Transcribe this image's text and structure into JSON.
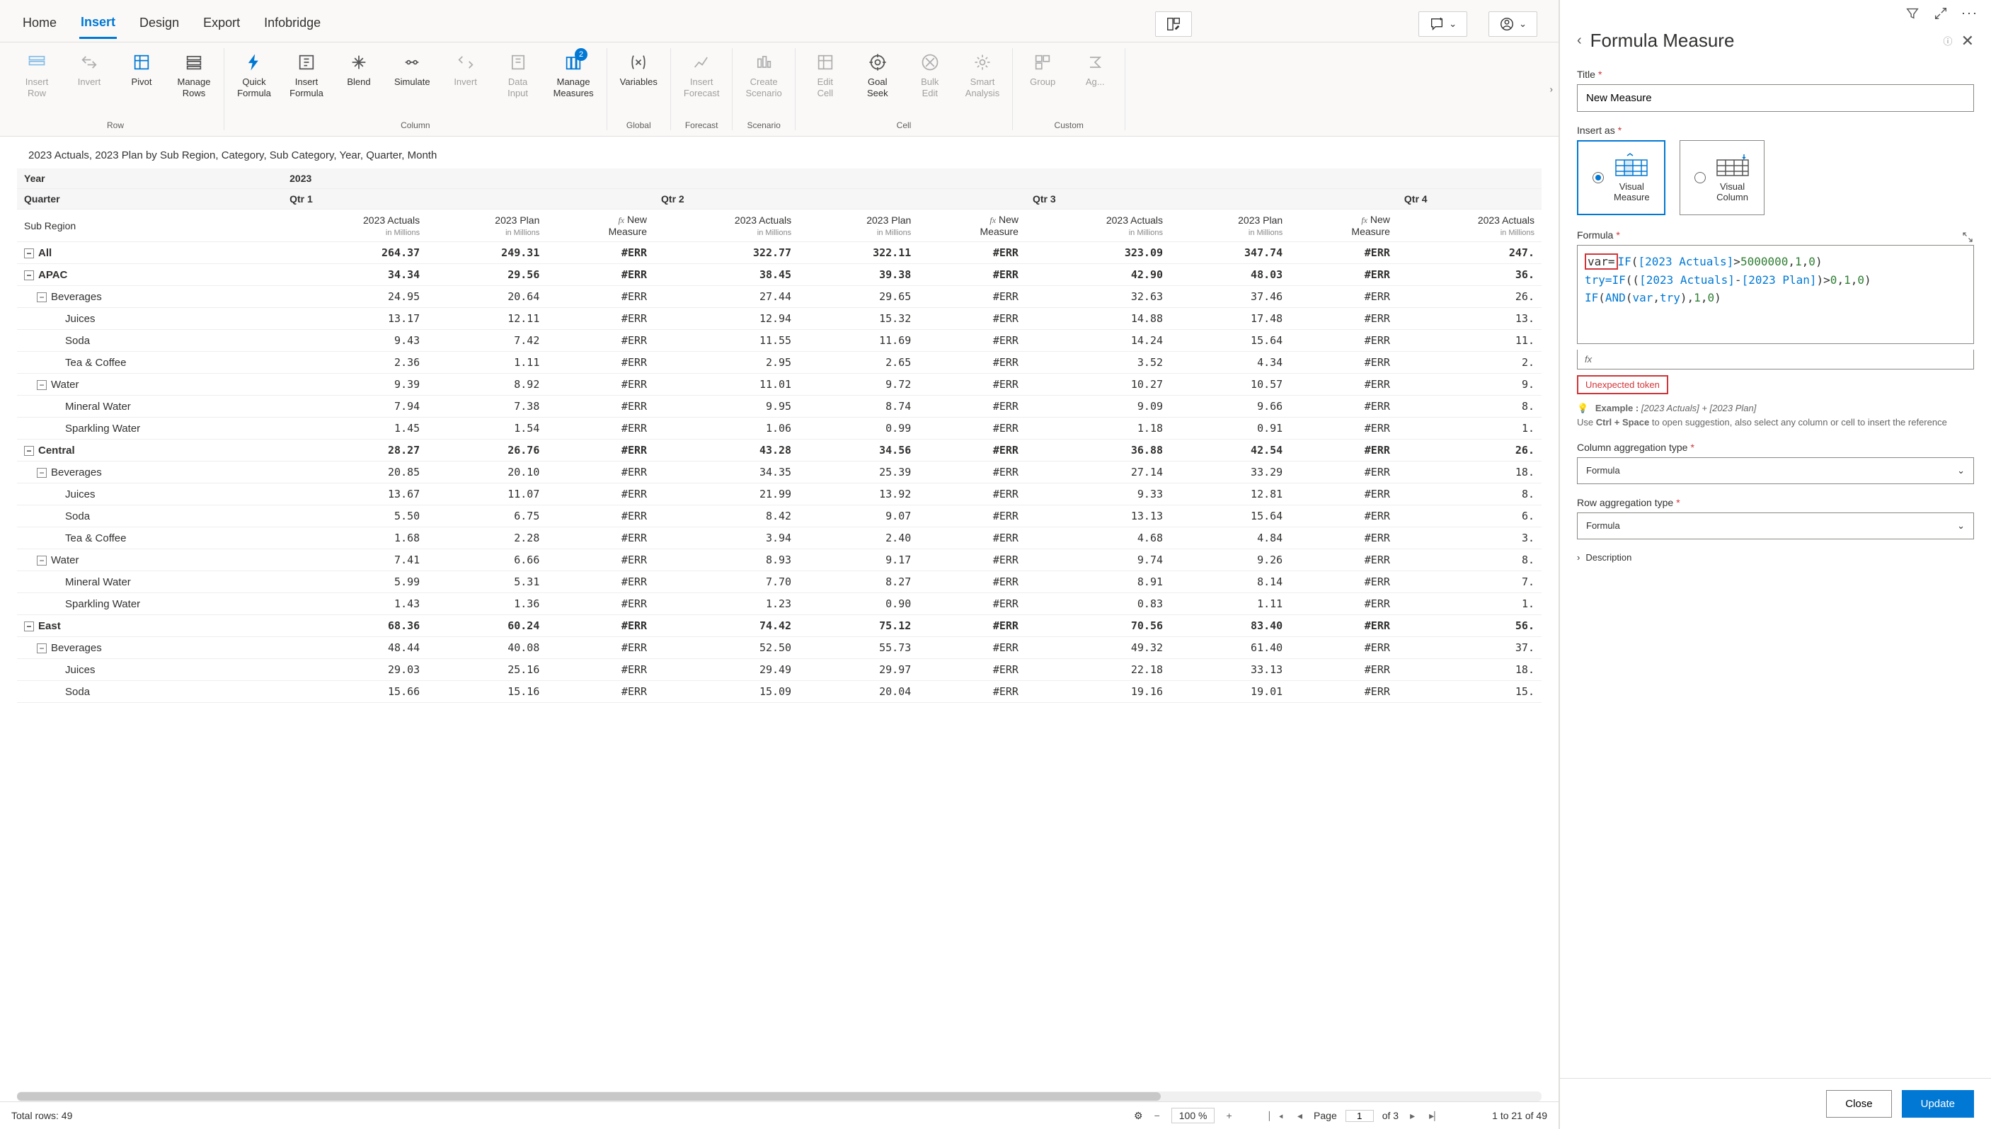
{
  "tabs": {
    "home": "Home",
    "insert": "Insert",
    "design": "Design",
    "export": "Export",
    "infobridge": "Infobridge"
  },
  "ribbon": {
    "groups": {
      "row": {
        "label": "Row",
        "insert_row": "Insert\nRow",
        "invert": "Invert",
        "pivot": "Pivot",
        "manage_rows": "Manage\nRows"
      },
      "column": {
        "label": "Column",
        "quick_formula": "Quick\nFormula",
        "insert_formula": "Insert\nFormula",
        "blend": "Blend",
        "simulate": "Simulate",
        "invert": "Invert",
        "data_input": "Data\nInput",
        "manage_measures": "Manage\nMeasures",
        "badge": "2"
      },
      "global": {
        "label": "Global",
        "variables": "Variables"
      },
      "forecast": {
        "label": "Forecast",
        "insert_forecast": "Insert\nForecast"
      },
      "scenario": {
        "label": "Scenario",
        "create_scenario": "Create\nScenario"
      },
      "cell": {
        "label": "Cell",
        "edit_cell": "Edit\nCell",
        "goal_seek": "Goal\nSeek",
        "bulk_edit": "Bulk\nEdit",
        "smart_analysis": "Smart\nAnalysis"
      },
      "custom": {
        "label": "Custom",
        "group": "Group",
        "aggregate": "Ag..."
      }
    }
  },
  "breadcrumb": "2023 Actuals, 2023 Plan by Sub Region, Category, Sub Category, Year, Quarter, Month",
  "headers": {
    "year_label": "Year",
    "quarter_label": "Quarter",
    "sub_region_label": "Sub Region",
    "year_value": "2023",
    "quarters": [
      "Qtr 1",
      "Qtr 2",
      "Qtr 3",
      "Qtr 4"
    ],
    "cols": {
      "actuals": "2023 Actuals",
      "plan": "2023 Plan",
      "new_measure": "New\nMeasure",
      "unit": "in Millions"
    }
  },
  "rows": [
    {
      "type": "all",
      "label": "All",
      "vals": [
        "264.37",
        "249.31",
        "#ERR",
        "322.77",
        "322.11",
        "#ERR",
        "323.09",
        "347.74",
        "#ERR",
        "247."
      ]
    },
    {
      "type": "region",
      "label": "APAC",
      "vals": [
        "34.34",
        "29.56",
        "#ERR",
        "38.45",
        "39.38",
        "#ERR",
        "42.90",
        "48.03",
        "#ERR",
        "36."
      ]
    },
    {
      "type": "cat",
      "label": "Beverages",
      "vals": [
        "24.95",
        "20.64",
        "#ERR",
        "27.44",
        "29.65",
        "#ERR",
        "32.63",
        "37.46",
        "#ERR",
        "26."
      ]
    },
    {
      "type": "item",
      "label": "Juices",
      "vals": [
        "13.17",
        "12.11",
        "#ERR",
        "12.94",
        "15.32",
        "#ERR",
        "14.88",
        "17.48",
        "#ERR",
        "13."
      ]
    },
    {
      "type": "item",
      "label": "Soda",
      "vals": [
        "9.43",
        "7.42",
        "#ERR",
        "11.55",
        "11.69",
        "#ERR",
        "14.24",
        "15.64",
        "#ERR",
        "11."
      ]
    },
    {
      "type": "item",
      "label": "Tea & Coffee",
      "vals": [
        "2.36",
        "1.11",
        "#ERR",
        "2.95",
        "2.65",
        "#ERR",
        "3.52",
        "4.34",
        "#ERR",
        "2."
      ]
    },
    {
      "type": "cat",
      "label": "Water",
      "vals": [
        "9.39",
        "8.92",
        "#ERR",
        "11.01",
        "9.72",
        "#ERR",
        "10.27",
        "10.57",
        "#ERR",
        "9."
      ]
    },
    {
      "type": "item",
      "label": "Mineral Water",
      "vals": [
        "7.94",
        "7.38",
        "#ERR",
        "9.95",
        "8.74",
        "#ERR",
        "9.09",
        "9.66",
        "#ERR",
        "8."
      ]
    },
    {
      "type": "item",
      "label": "Sparkling Water",
      "vals": [
        "1.45",
        "1.54",
        "#ERR",
        "1.06",
        "0.99",
        "#ERR",
        "1.18",
        "0.91",
        "#ERR",
        "1."
      ]
    },
    {
      "type": "region",
      "label": "Central",
      "vals": [
        "28.27",
        "26.76",
        "#ERR",
        "43.28",
        "34.56",
        "#ERR",
        "36.88",
        "42.54",
        "#ERR",
        "26."
      ]
    },
    {
      "type": "cat",
      "label": "Beverages",
      "vals": [
        "20.85",
        "20.10",
        "#ERR",
        "34.35",
        "25.39",
        "#ERR",
        "27.14",
        "33.29",
        "#ERR",
        "18."
      ]
    },
    {
      "type": "item",
      "label": "Juices",
      "vals": [
        "13.67",
        "11.07",
        "#ERR",
        "21.99",
        "13.92",
        "#ERR",
        "9.33",
        "12.81",
        "#ERR",
        "8."
      ]
    },
    {
      "type": "item",
      "label": "Soda",
      "vals": [
        "5.50",
        "6.75",
        "#ERR",
        "8.42",
        "9.07",
        "#ERR",
        "13.13",
        "15.64",
        "#ERR",
        "6."
      ]
    },
    {
      "type": "item",
      "label": "Tea & Coffee",
      "vals": [
        "1.68",
        "2.28",
        "#ERR",
        "3.94",
        "2.40",
        "#ERR",
        "4.68",
        "4.84",
        "#ERR",
        "3."
      ]
    },
    {
      "type": "cat",
      "label": "Water",
      "vals": [
        "7.41",
        "6.66",
        "#ERR",
        "8.93",
        "9.17",
        "#ERR",
        "9.74",
        "9.26",
        "#ERR",
        "8."
      ]
    },
    {
      "type": "item",
      "label": "Mineral Water",
      "vals": [
        "5.99",
        "5.31",
        "#ERR",
        "7.70",
        "8.27",
        "#ERR",
        "8.91",
        "8.14",
        "#ERR",
        "7."
      ]
    },
    {
      "type": "item",
      "label": "Sparkling Water",
      "vals": [
        "1.43",
        "1.36",
        "#ERR",
        "1.23",
        "0.90",
        "#ERR",
        "0.83",
        "1.11",
        "#ERR",
        "1."
      ]
    },
    {
      "type": "region",
      "label": "East",
      "vals": [
        "68.36",
        "60.24",
        "#ERR",
        "74.42",
        "75.12",
        "#ERR",
        "70.56",
        "83.40",
        "#ERR",
        "56."
      ]
    },
    {
      "type": "cat",
      "label": "Beverages",
      "vals": [
        "48.44",
        "40.08",
        "#ERR",
        "52.50",
        "55.73",
        "#ERR",
        "49.32",
        "61.40",
        "#ERR",
        "37."
      ]
    },
    {
      "type": "item",
      "label": "Juices",
      "vals": [
        "29.03",
        "25.16",
        "#ERR",
        "29.49",
        "29.97",
        "#ERR",
        "22.18",
        "33.13",
        "#ERR",
        "18."
      ]
    },
    {
      "type": "item",
      "label": "Soda",
      "vals": [
        "15.66",
        "15.16",
        "#ERR",
        "15.09",
        "20.04",
        "#ERR",
        "19.16",
        "19.01",
        "#ERR",
        "15."
      ]
    }
  ],
  "status": {
    "total_rows": "Total rows: 49",
    "zoom": "100 %",
    "page_label": "Page",
    "page_current": "1",
    "page_of": "of 3",
    "range": "1  to  21  of  49"
  },
  "panel": {
    "title": "Formula Measure",
    "title_label": "Title",
    "title_value": "New Measure",
    "insert_as_label": "Insert as",
    "opt_measure": "Visual\nMeasure",
    "opt_column": "Visual\nColumn",
    "formula_label": "Formula",
    "formula_lines": {
      "l1a": "var=",
      "l1b": "IF",
      "l1c": "(",
      "l1d": "[2023 Actuals]",
      "l1e": ">",
      "l1f": "5000000",
      "l1g": ",",
      "l1h": "1",
      "l1i": ",",
      "l1j": "0",
      "l1k": ")",
      "l2a": "try=",
      "l2b": "IF",
      "l2c": "((",
      "l2d": "[2023 Actuals]",
      "l2e": "-",
      "l2f": "[2023 Plan]",
      "l2g": ")>",
      "l2h": "0",
      "l2i": ",",
      "l2j": "1",
      "l2k": ",",
      "l2l": "0",
      "l2m": ")",
      "l3a": "IF",
      "l3b": "(",
      "l3c": "AND",
      "l3d": "(",
      "l3e": "var",
      "l3f": ",",
      "l3g": "try",
      "l3h": "),",
      "l3i": "1",
      "l3j": ",",
      "l3k": "0",
      "l3l": ")"
    },
    "fx_placeholder": "fx",
    "error_msg": "Unexpected token",
    "hint_example_label": "Example :",
    "hint_example": "[2023 Actuals] + [2023 Plan]",
    "hint_text1": "Use ",
    "hint_key": "Ctrl + Space",
    "hint_text2": " to open suggestion, also select any column or cell to insert the reference",
    "col_agg_label": "Column aggregation type",
    "col_agg_value": "Formula",
    "row_agg_label": "Row aggregation type",
    "row_agg_value": "Formula",
    "description_label": "Description",
    "close_btn": "Close",
    "update_btn": "Update"
  }
}
